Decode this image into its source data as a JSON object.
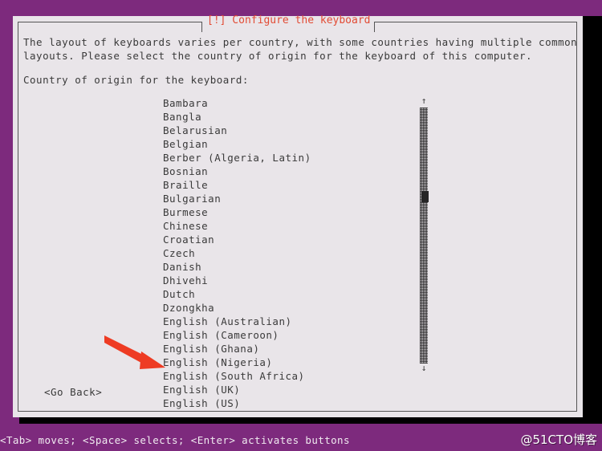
{
  "screen": {
    "background_color": "#7d2a7d",
    "terminal_backdrop_color": "#000000"
  },
  "dialog": {
    "title": "[!] Configure the keyboard",
    "title_color": "#e24b34",
    "background_color": "#e9e5e9",
    "border_color": "#555555",
    "paragraph_line_1": "The layout of keyboards varies per country, with some countries having multiple common",
    "paragraph_line_2": "layouts. Please select the country of origin for the keyboard of this computer.",
    "prompt_label": "Country of origin for the keyboard:",
    "go_back_button": "<Go Back>"
  },
  "list": {
    "selected_index": 23,
    "selected_value": "English (US)",
    "highlight_color": "#e03b24",
    "highlight_text_color": "#f2dcd8",
    "items": [
      {
        "label": "Bambara"
      },
      {
        "label": "Bangla"
      },
      {
        "label": "Belarusian"
      },
      {
        "label": "Belgian"
      },
      {
        "label": "Berber (Algeria, Latin)"
      },
      {
        "label": "Bosnian"
      },
      {
        "label": "Braille"
      },
      {
        "label": "Bulgarian"
      },
      {
        "label": "Burmese"
      },
      {
        "label": "Chinese"
      },
      {
        "label": "Croatian"
      },
      {
        "label": "Czech"
      },
      {
        "label": "Danish"
      },
      {
        "label": "Dhivehi"
      },
      {
        "label": "Dutch"
      },
      {
        "label": "Dzongkha"
      },
      {
        "label": "English (Australian)"
      },
      {
        "label": "English (Cameroon)"
      },
      {
        "label": "English (Ghana)"
      },
      {
        "label": "English (Nigeria)"
      },
      {
        "label": "English (South Africa)"
      },
      {
        "label": "English (UK)"
      },
      {
        "label": "English (US)"
      }
    ]
  },
  "scrollbar": {
    "up_arrow_glyph": "↑",
    "down_arrow_glyph": "↓",
    "thumb_position_percent": 34
  },
  "annotation": {
    "arrow_color": "#ee3b23",
    "points_at": "English (US)"
  },
  "status_bar": {
    "hint": "<Tab> moves; <Space> selects; <Enter> activates buttons",
    "watermark": "@51CTO博客",
    "background_color": "#7d2a7d"
  }
}
